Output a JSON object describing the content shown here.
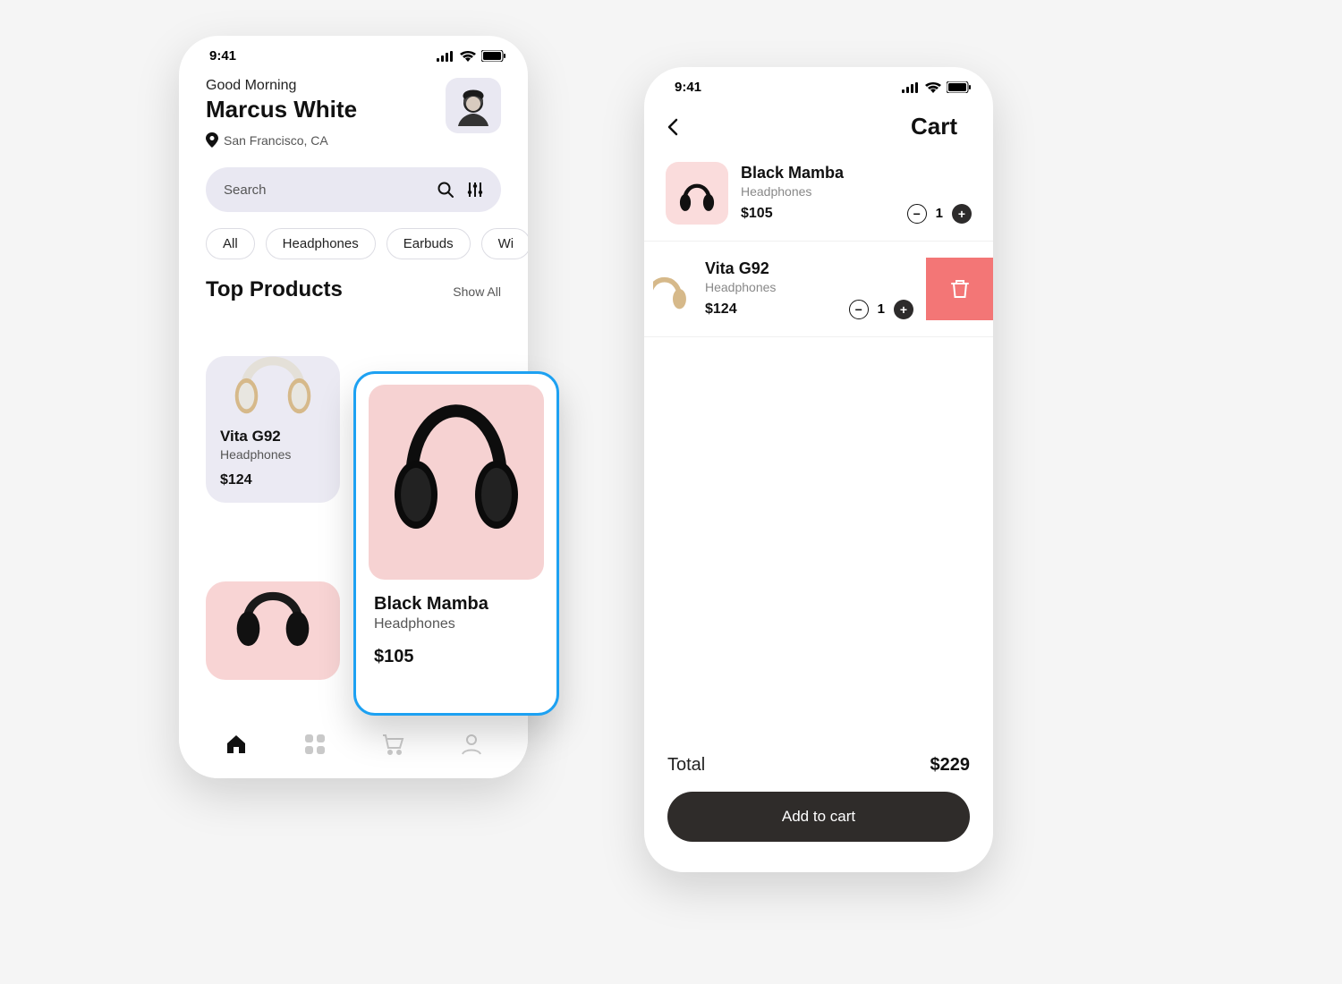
{
  "status_time": "9:41",
  "home": {
    "greeting": "Good Morning",
    "username": "Marcus White",
    "location": "San Francisco, CA",
    "search_placeholder": "Search",
    "chips": [
      "All",
      "Headphones",
      "Earbuds",
      "Wi"
    ],
    "section_title": "Top Products",
    "show_all": "Show All",
    "top_products": [
      {
        "name": "Vita G92",
        "category": "Headphones",
        "price": "$124"
      },
      {
        "name": "Black Mamba",
        "category": "Headphones",
        "price": "$105"
      }
    ]
  },
  "cart": {
    "title": "Cart",
    "items": [
      {
        "name": "Black Mamba",
        "category": "Headphones",
        "price": "$105",
        "qty": "1"
      },
      {
        "name": "Vita G92",
        "category": "Headphones",
        "price": "$124",
        "qty": "1"
      }
    ],
    "total_label": "Total",
    "total_value": "$229",
    "cta": "Add to cart"
  }
}
